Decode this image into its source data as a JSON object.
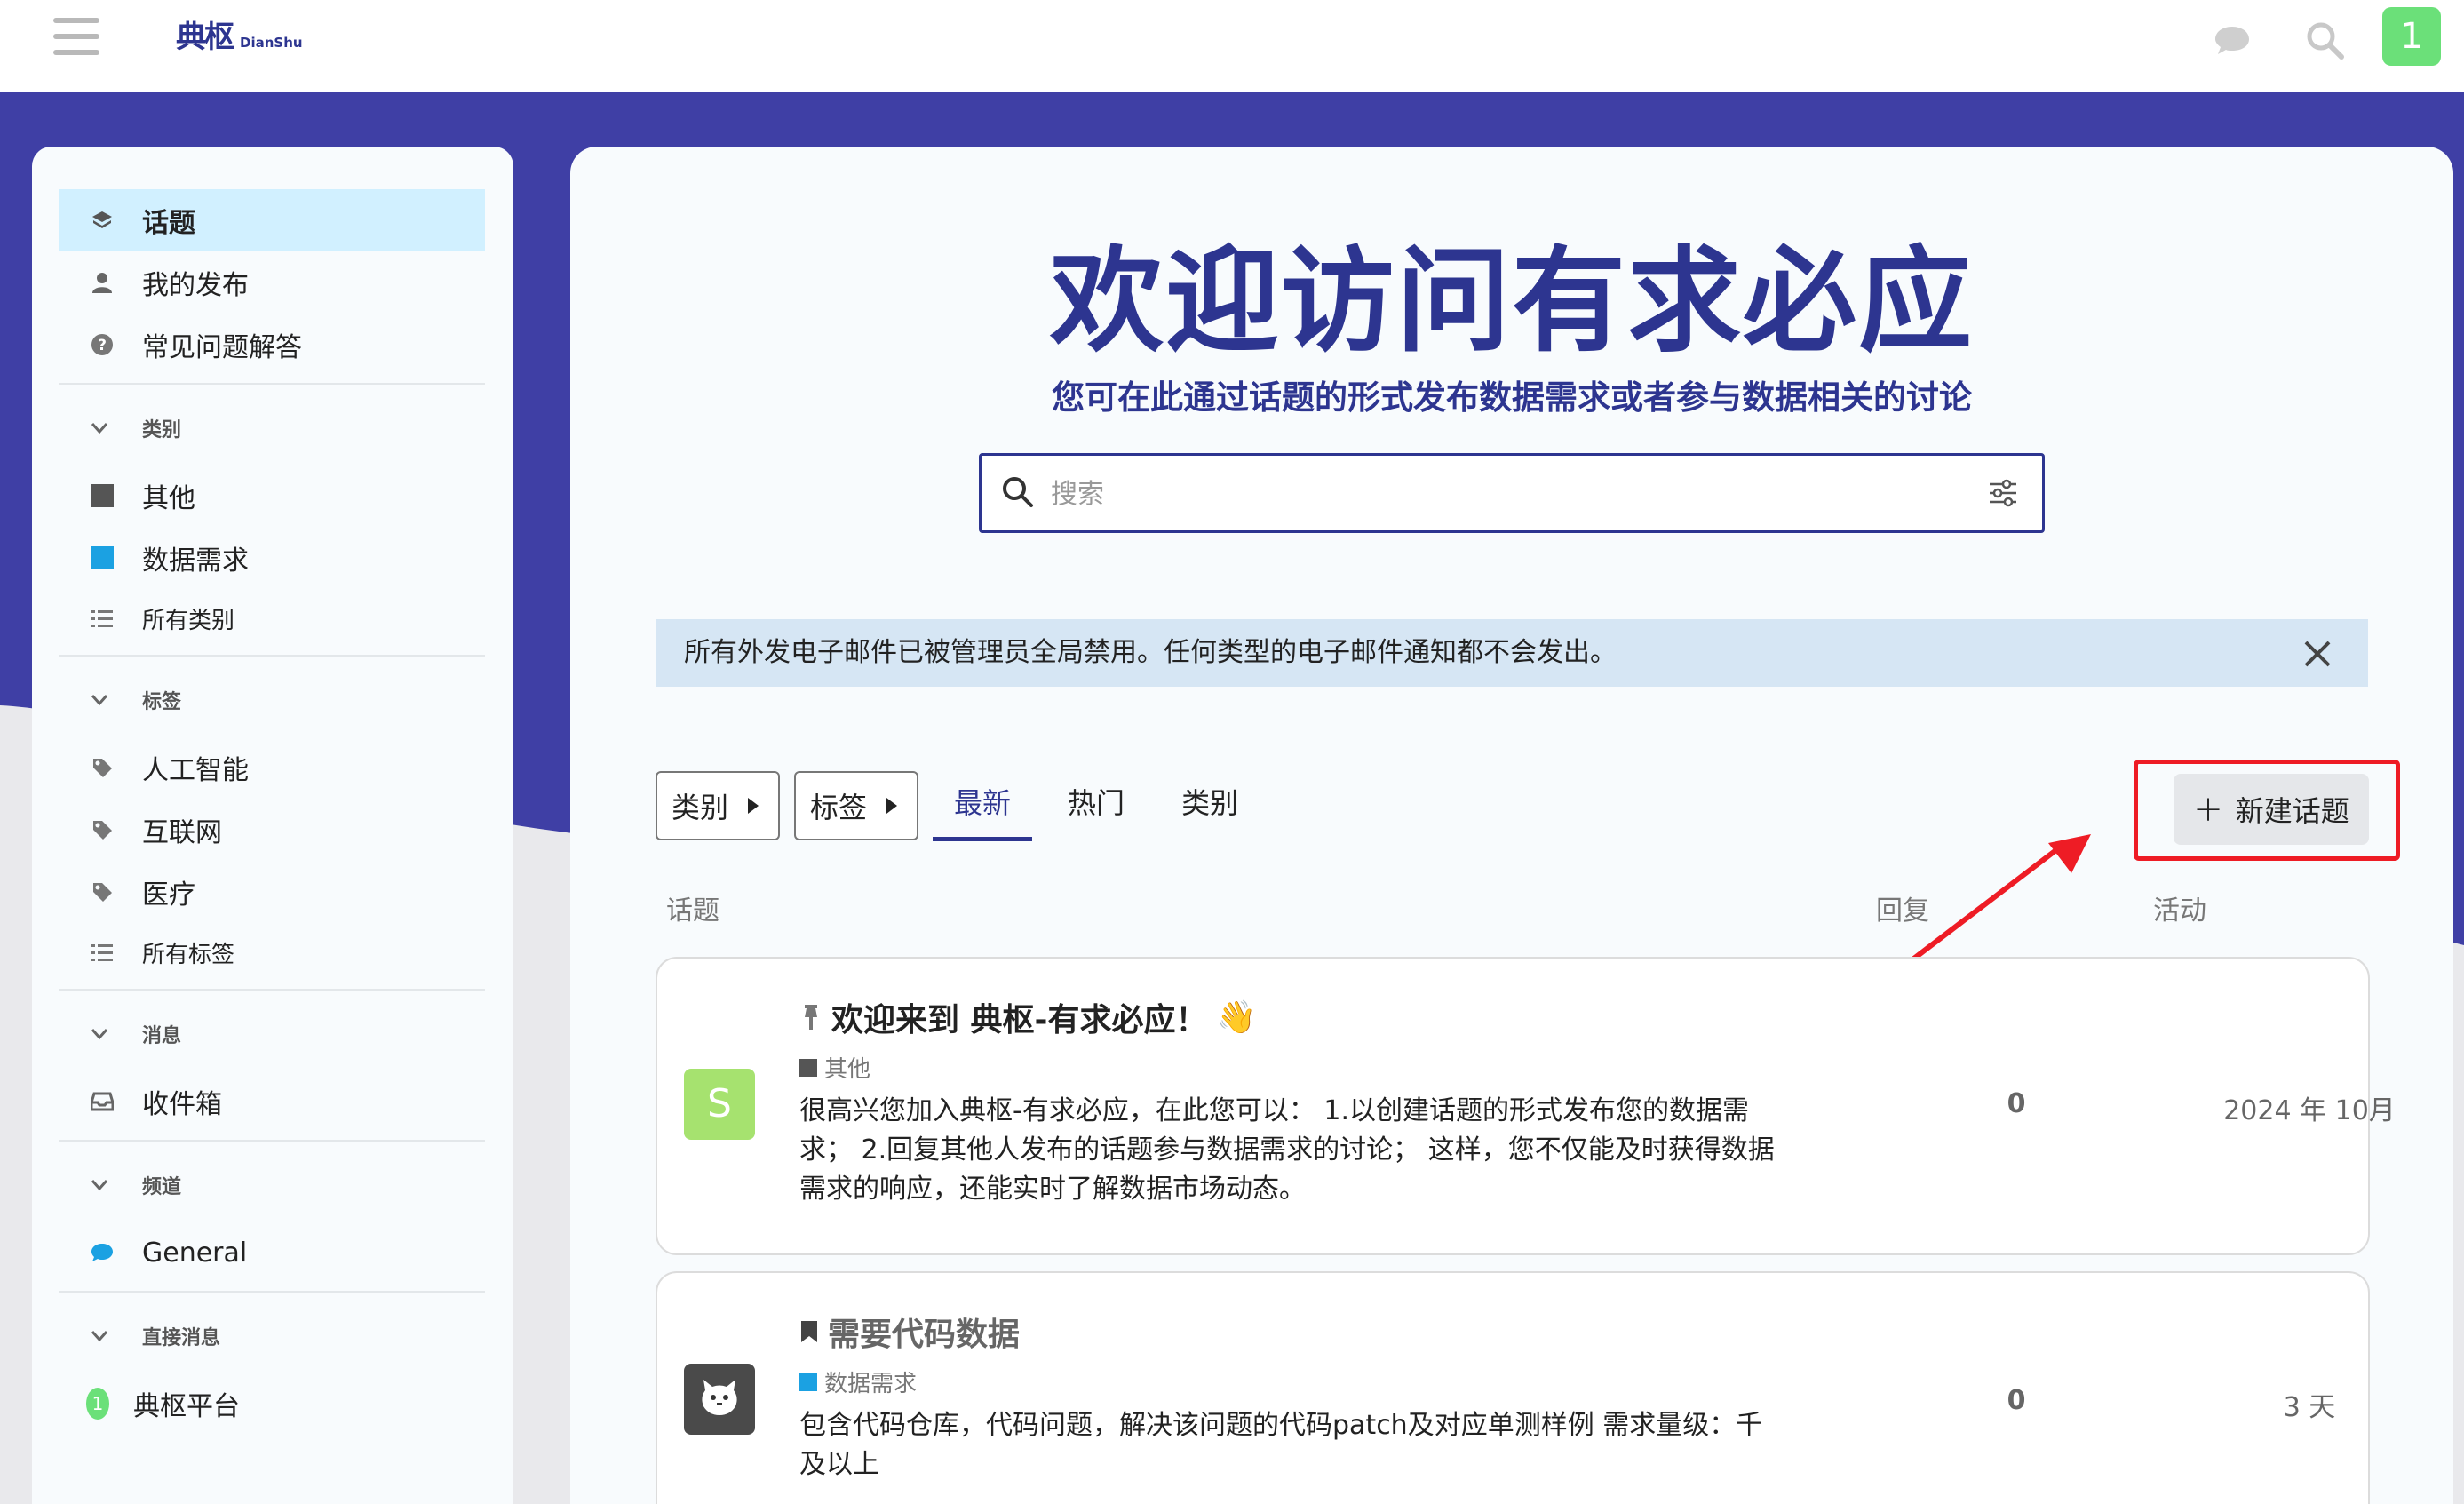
{
  "header": {
    "logo_cn": "典枢",
    "logo_en": "DianShu",
    "user_initial": "1"
  },
  "sidebar": {
    "primary": [
      {
        "label": "话题",
        "icon": "layers-icon"
      },
      {
        "label": "我的发布",
        "icon": "user-icon"
      },
      {
        "label": "常见问题解答",
        "icon": "question-icon"
      }
    ],
    "categories": {
      "heading": "类别",
      "items": [
        {
          "label": "其他",
          "color": "#555555"
        },
        {
          "label": "数据需求",
          "color": "#1ba1e2"
        }
      ],
      "all_label": "所有类别"
    },
    "tags": {
      "heading": "标签",
      "items": [
        "人工智能",
        "互联网",
        "医疗"
      ],
      "all_label": "所有标签"
    },
    "messages": {
      "heading": "消息",
      "inbox_label": "收件箱"
    },
    "channels": {
      "heading": "频道",
      "general_label": "General"
    },
    "direct": {
      "heading": "直接消息",
      "item_label": "典枢平台",
      "item_badge": "1"
    }
  },
  "main": {
    "hero_title": "欢迎访问有求必应",
    "hero_subtitle": "您可在此通过话题的形式发布数据需求或者参与数据相关的讨论",
    "search_placeholder": "搜索",
    "notice": "所有外发电子邮件已被管理员全局禁用。任何类型的电子邮件通知都不会发出。",
    "filters": {
      "category_dropdown": "类别",
      "tag_dropdown": "标签",
      "tabs": [
        "最新",
        "热门",
        "类别"
      ],
      "active_tab": "最新",
      "new_topic": "新建话题"
    },
    "columns": {
      "topic": "话题",
      "replies": "回复",
      "activity": "活动"
    },
    "topics": [
      {
        "title": "欢迎来到 典枢-有求必应！",
        "emoji": "👋",
        "category": "其他",
        "category_color": "#555555",
        "avatar_letter": "S",
        "avatar_color": "#a6e26f",
        "excerpt": "很高兴您加入典枢-有求必应，在此您可以： 1.以创建话题的形式发布您的数据需求； 2.回复其他人发布的话题参与数据需求的讨论； 这样，您不仅能及时获得数据需求的响应，还能实时了解数据市场动态。",
        "replies": "0",
        "activity": "2024 年 10月"
      },
      {
        "title": "需要代码数据",
        "category": "数据需求",
        "category_color": "#1ba1e2",
        "avatar_color": "#4a4a4a",
        "excerpt": "包含代码仓库，代码问题，解决该问题的代码patch及对应单测样例 需求量级：千及以上",
        "replies": "0",
        "activity": "3 天"
      }
    ]
  },
  "colors": {
    "brand": "#2d3590",
    "band": "#3f3fa5",
    "active_nav": "#d1f0ff",
    "annotation_red": "#ee1c25"
  }
}
